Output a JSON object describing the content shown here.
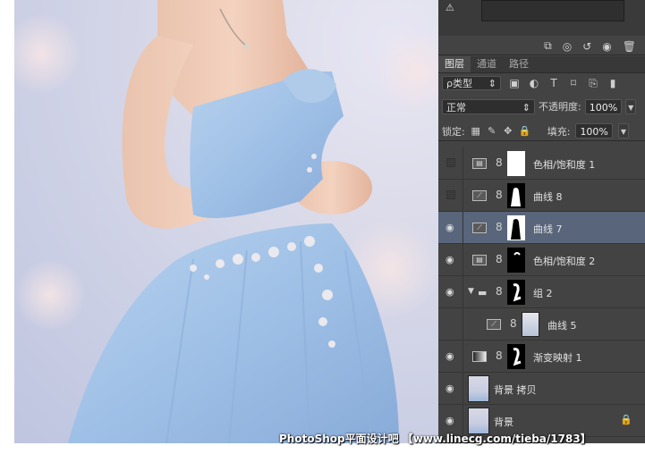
{
  "panel": {
    "tabs": [
      {
        "label": "图层",
        "active": true
      },
      {
        "label": "通道",
        "active": false
      },
      {
        "label": "路径",
        "active": false
      }
    ],
    "filter": {
      "label": "ρ类型",
      "arrow": "⇕"
    },
    "blend_mode": {
      "value": "正常",
      "arrow": "⇕"
    },
    "opacity": {
      "label": "不透明度:",
      "value": "100%"
    },
    "lock": {
      "label": "锁定:"
    },
    "fill": {
      "label": "填充:",
      "value": "100%"
    },
    "layers": [
      {
        "name": "色相/饱和度 1",
        "visible": false,
        "type": "hue-saturation",
        "mask": "white"
      },
      {
        "name": "曲线 8",
        "visible": false,
        "type": "curves",
        "mask": "black-silhouette"
      },
      {
        "name": "曲线 7",
        "visible": true,
        "type": "curves",
        "mask": "black-silhouette",
        "selected": true
      },
      {
        "name": "色相/饱和度 2",
        "visible": true,
        "type": "hue-saturation",
        "mask": "black-small"
      },
      {
        "name": "组 2",
        "visible": true,
        "type": "group",
        "mask": "black-shape"
      },
      {
        "name": "曲线 5",
        "visible": false,
        "type": "curves",
        "mask": "photo"
      },
      {
        "name": "渐变映射 1",
        "visible": true,
        "type": "gradient-map",
        "mask": "black-shape"
      },
      {
        "name": "背景 拷贝",
        "visible": true,
        "type": "pixel",
        "mask": "none"
      },
      {
        "name": "背景",
        "visible": true,
        "type": "pixel",
        "mask": "none",
        "locked": true
      }
    ]
  },
  "watermark": "PhotoShop平面设计吧 【www.linecg.com/tieba/1783】",
  "colors": {
    "panel_bg": "#434343",
    "selected_layer": "#58657a",
    "dress_blue": "#a9c6e8",
    "background": "#cfd2e6"
  }
}
